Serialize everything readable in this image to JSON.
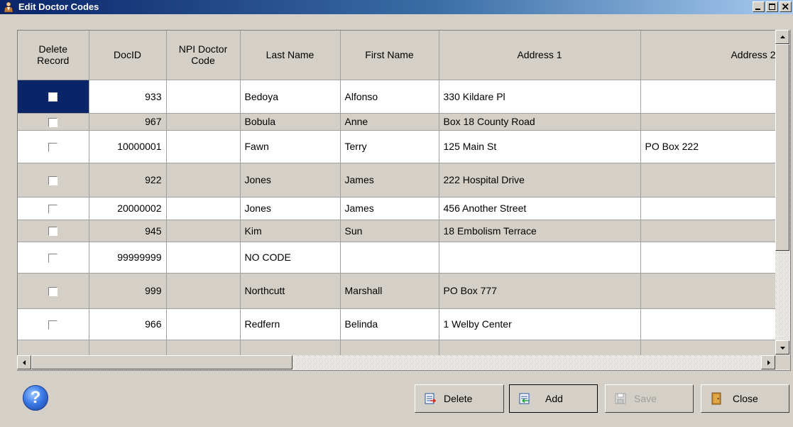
{
  "window": {
    "title": "Edit Doctor Codes",
    "icon": "user-icon",
    "controls": [
      "minimize-icon",
      "restore-icon",
      "close-icon"
    ]
  },
  "grid": {
    "columns": [
      "Delete Record",
      "DocID",
      "NPI Doctor Code",
      "Last Name",
      "First Name",
      "Address 1",
      "Address 2"
    ],
    "rows": [
      {
        "docid": "933",
        "npi": "",
        "last": "Bedoya",
        "first": "Alfonso",
        "addr1": "330 Kildare Pl",
        "addr2": ""
      },
      {
        "docid": "967",
        "npi": "",
        "last": "Bobula",
        "first": "Anne",
        "addr1": "Box 18 County Road",
        "addr2": ""
      },
      {
        "docid": "10000001",
        "npi": "",
        "last": "Fawn",
        "first": "Terry",
        "addr1": "125 Main St",
        "addr2": "PO Box 222"
      },
      {
        "docid": "922",
        "npi": "",
        "last": "Jones",
        "first": "James",
        "addr1": "222 Hospital Drive",
        "addr2": ""
      },
      {
        "docid": "20000002",
        "npi": "",
        "last": "Jones",
        "first": "James",
        "addr1": "456 Another Street",
        "addr2": ""
      },
      {
        "docid": "945",
        "npi": "",
        "last": "Kim",
        "first": "Sun",
        "addr1": "18 Embolism Terrace",
        "addr2": ""
      },
      {
        "docid": "99999999",
        "npi": "",
        "last": "NO CODE",
        "first": "",
        "addr1": "",
        "addr2": ""
      },
      {
        "docid": "999",
        "npi": "",
        "last": "Northcutt",
        "first": "Marshall",
        "addr1": "PO Box 777",
        "addr2": ""
      },
      {
        "docid": "966",
        "npi": "",
        "last": "Redfern",
        "first": "Belinda",
        "addr1": "1 Welby Center",
        "addr2": ""
      }
    ]
  },
  "buttons": {
    "help": "?",
    "delete": "Delete",
    "add": "Add",
    "save": "Save",
    "close": "Close"
  },
  "icons": {
    "help": "help-icon",
    "delete": "delete-icon",
    "add": "add-icon",
    "save": "save-icon",
    "close": "door-icon"
  }
}
